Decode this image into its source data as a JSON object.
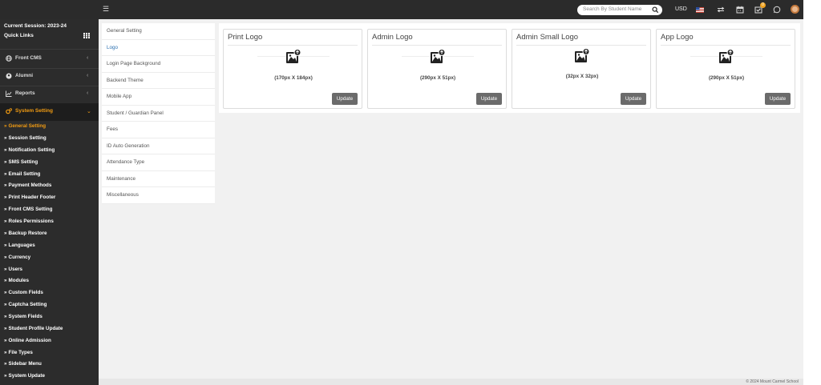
{
  "topbar": {
    "menu_icon": "hamburger-icon",
    "search_placeholder": "Search By Student Name",
    "currency": "USD",
    "icons": [
      "flag-us-icon",
      "switch-icon",
      "calendar-icon",
      "task-check-icon",
      "whatsapp-icon",
      "user-avatar"
    ],
    "task_badge": "0"
  },
  "sidebar": {
    "session": "Current Session: 2023-24",
    "quick_links": "Quick Links",
    "modules": [
      {
        "label": "Front CMS",
        "icon": "globe-icon"
      },
      {
        "label": "Alumni",
        "icon": "alumni-icon"
      },
      {
        "label": "Reports",
        "icon": "line-chart-icon"
      },
      {
        "label": "System Setting",
        "icon": "gears-icon"
      }
    ],
    "submenu": [
      "General Setting",
      "Session Setting",
      "Notification Setting",
      "SMS Setting",
      "Email Setting",
      "Payment Methods",
      "Print Header Footer",
      "Front CMS Setting",
      "Roles Permissions",
      "Backup Restore",
      "Languages",
      "Currency",
      "Users",
      "Modules",
      "Custom Fields",
      "Captcha Setting",
      "System Fields",
      "Student Profile Update",
      "Online Admission",
      "File Types",
      "Sidebar Menu",
      "System Update"
    ],
    "active_submenu": "General Setting"
  },
  "settings_menu": [
    "General Setting",
    "Logo",
    "Login Page Background",
    "Backend Theme",
    "Mobile App",
    "Student / Guardian Panel",
    "Fees",
    "ID Auto Generation",
    "Attendance Type",
    "Maintenance",
    "Miscellaneous"
  ],
  "active_setting": "Logo",
  "logo_cards": [
    {
      "title": "Print Logo",
      "size": "(170px X 184px)",
      "button": "Update"
    },
    {
      "title": "Admin Logo",
      "size": "(290px X 51px)",
      "button": "Update"
    },
    {
      "title": "Admin Small Logo",
      "size": "(32px X 32px)",
      "button": "Update"
    },
    {
      "title": "App Logo",
      "size": "(290px X 51px)",
      "button": "Update"
    }
  ],
  "footer": "© 2024 Mount Carmel School",
  "colors": {
    "accent": "#f39c12",
    "sidebar_bg": "#2c2c2c",
    "link": "#2a6fb0"
  }
}
